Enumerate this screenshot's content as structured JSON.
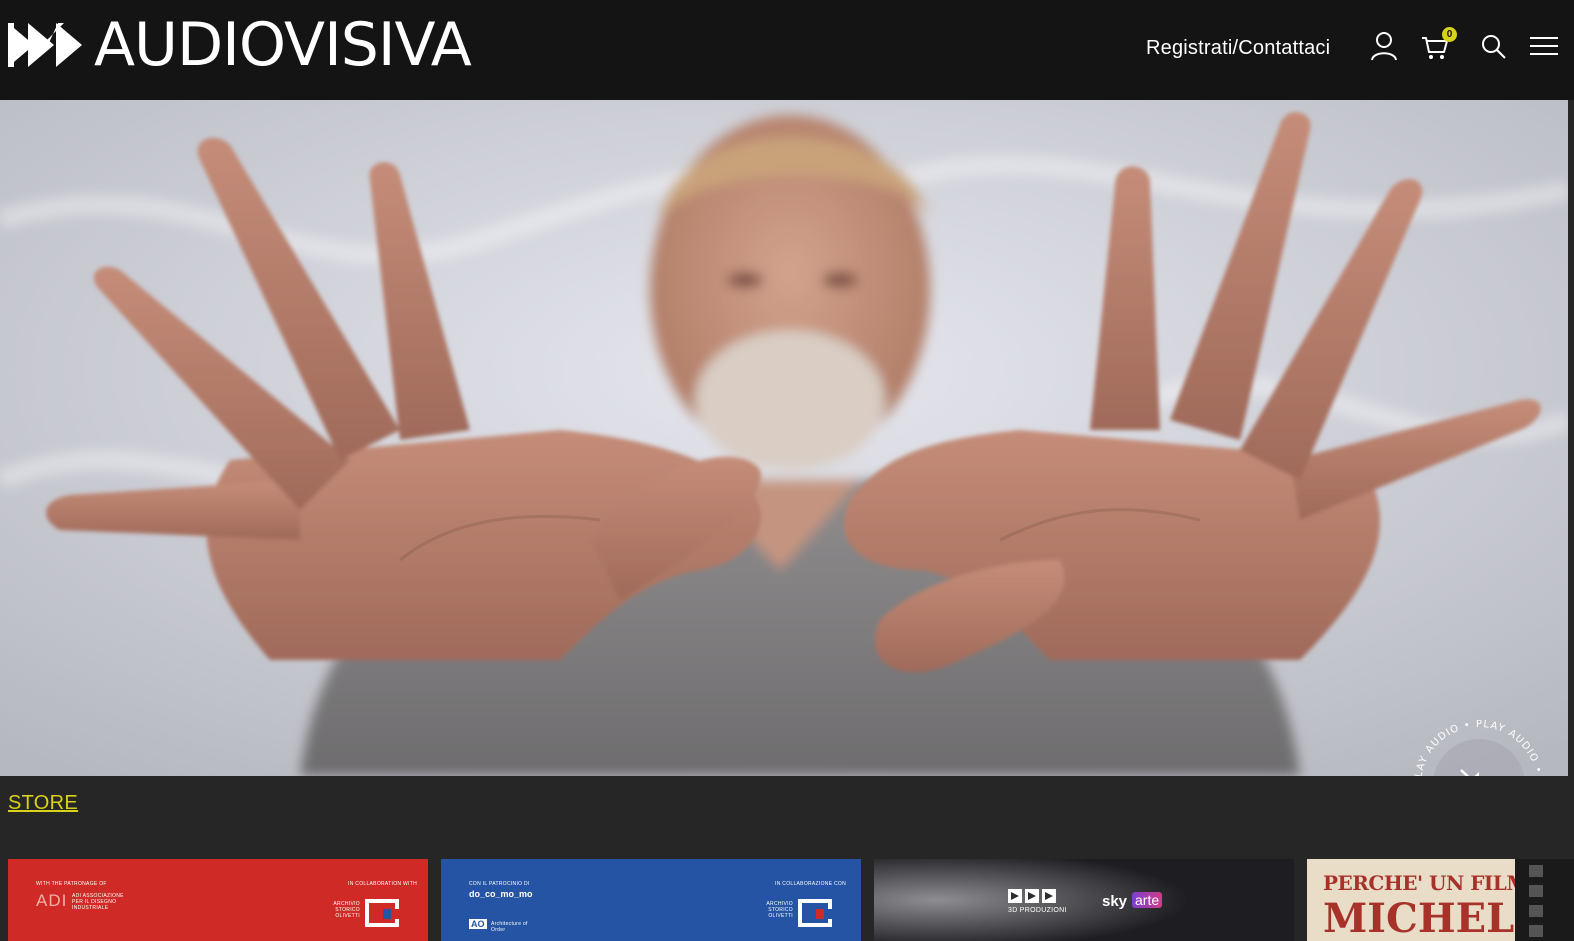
{
  "brand": {
    "name": "AUDIOVISIVA"
  },
  "header": {
    "nav_link": "Registrati/Contattaci",
    "cart_count": "0",
    "icons": [
      "user-icon",
      "cart-icon",
      "search-icon",
      "menu-icon"
    ]
  },
  "hero": {
    "play_audio_label": "PLAY AUDIO • PLAY AUDIO • PLAY AUDIO •"
  },
  "store": {
    "label": "STORE"
  },
  "cards": [
    {
      "top_left": "WITH THE PATRONAGE OF",
      "logo_left": "ADI",
      "logo_left_text": "ADI ASSOCIAZIONE PER IL DISEGNO INDUSTRIALE",
      "top_right": "IN COLLABORATION WITH",
      "right_text": "ARCHIVIO STORICO OLIVETTI"
    },
    {
      "top_left": "CON IL PATROCINIO DI",
      "logo_left": "do_co_mo_mo",
      "logo_left_sub": "AO",
      "logo_left_sub_text": "Architecture of Order",
      "top_right": "IN COLLABORAZIONE CON",
      "right_text": "ARCHIVIO STORICO OLIVETTI"
    },
    {
      "logo_left": "3D PRODUZIONI",
      "logo_right_a": "sky",
      "logo_right_b": "arte"
    },
    {
      "title_line1": "PERCHE' UN FILM SU",
      "title_line2": "MICHELE"
    }
  ],
  "colors": {
    "header_bg": "#141414",
    "accent": "#d9d21a",
    "page_bg": "#262626"
  }
}
